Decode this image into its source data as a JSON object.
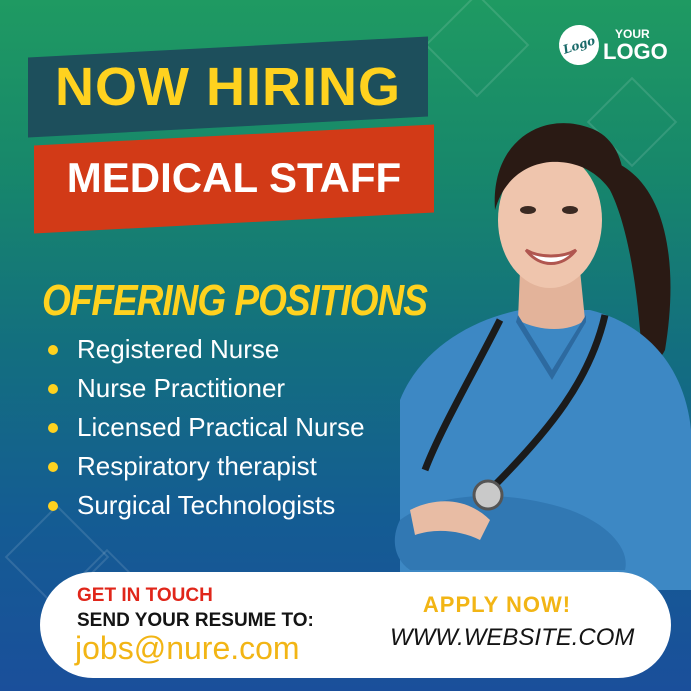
{
  "logo": {
    "mark": "Logo",
    "your": "YOUR",
    "logo": "LOGO"
  },
  "headline": {
    "line1": "NOW HIRING",
    "line2": "MEDICAL STAFF"
  },
  "positions": {
    "heading": "OFFERING POSITIONS",
    "items": [
      "Registered Nurse",
      "Nurse Practitioner",
      "Licensed Practical Nurse",
      "Respiratory therapist",
      "Surgical Technologists"
    ]
  },
  "contact": {
    "get_in_touch": "GET IN TOUCH",
    "send_resume": "SEND YOUR RESUME TO:",
    "email": "jobs@nure.com",
    "apply": "APPLY NOW!",
    "website": "WWW.WEBSITE.COM"
  },
  "colors": {
    "accent_yellow": "#ffd21f",
    "banner_dark": "#1d4f5c",
    "banner_red": "#d23a17",
    "touch_red": "#e0261a"
  },
  "image": {
    "subject": "nurse-photo"
  }
}
